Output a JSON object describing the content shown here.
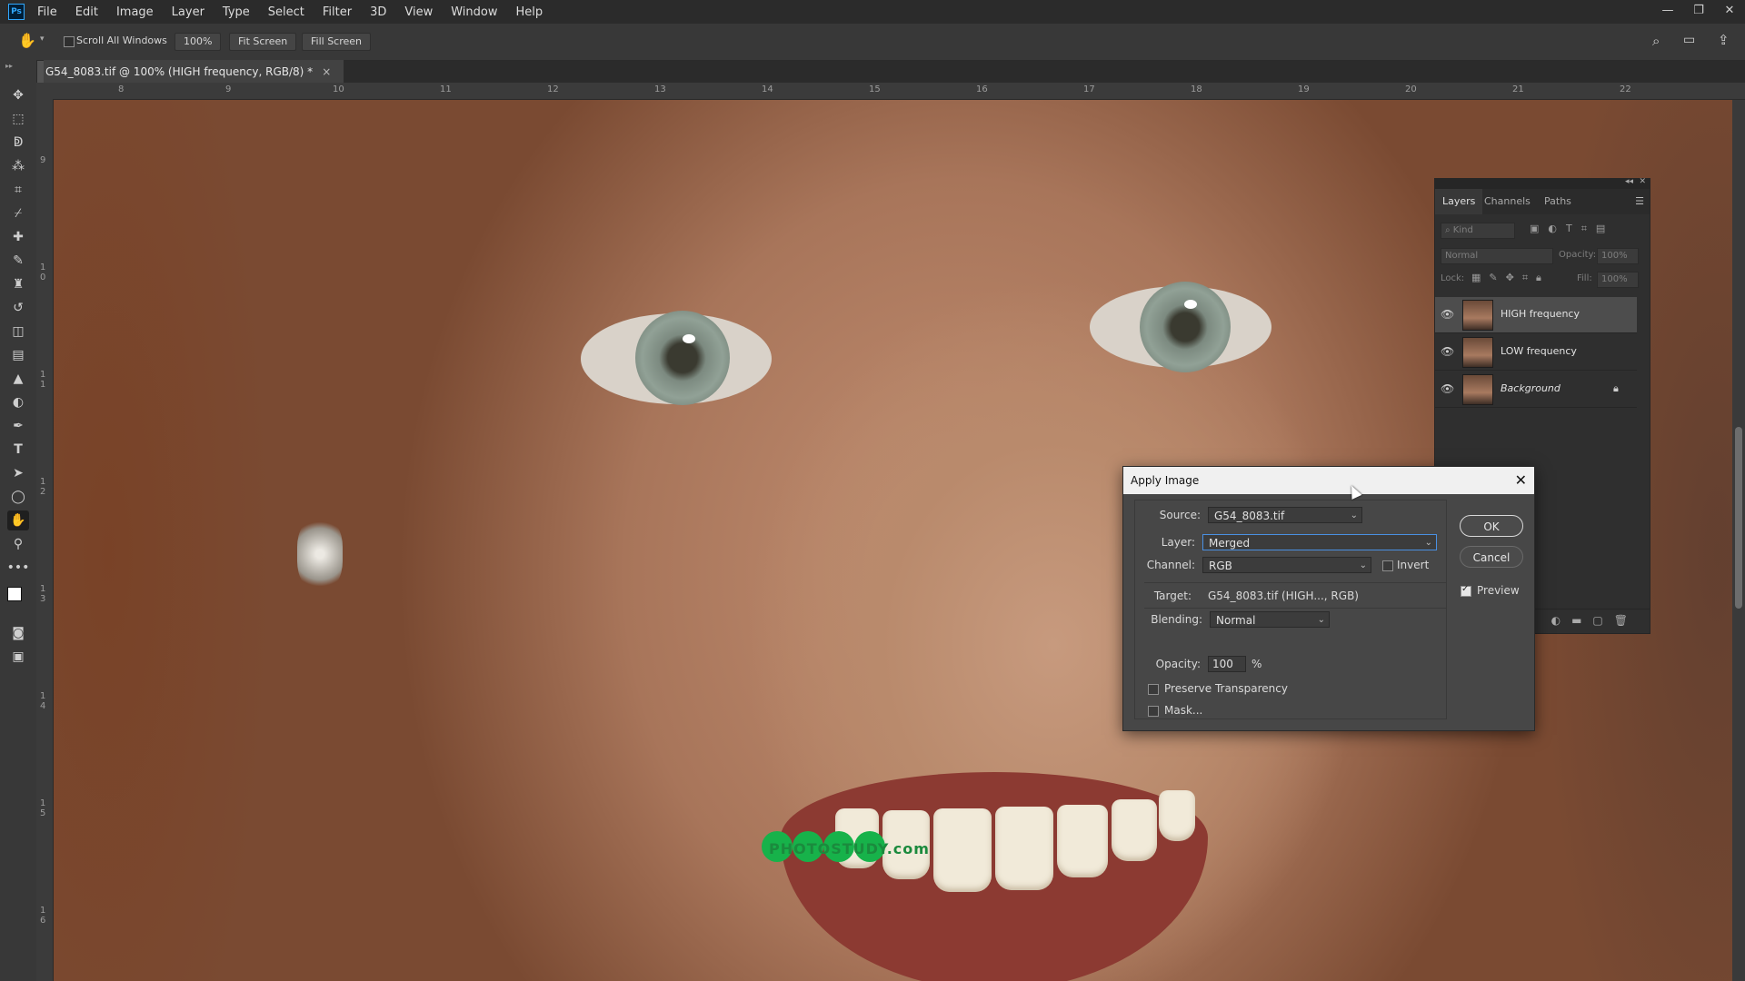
{
  "menubar": {
    "logo": "Ps",
    "items": [
      "File",
      "Edit",
      "Image",
      "Layer",
      "Type",
      "Select",
      "Filter",
      "3D",
      "View",
      "Window",
      "Help"
    ]
  },
  "options": {
    "scroll_all_windows": "Scroll All Windows",
    "zoom": "100%",
    "fit_screen": "Fit Screen",
    "fill_screen": "Fill Screen"
  },
  "document": {
    "tab_title": "G54_8083.tif @ 100% (HIGH frequency, RGB/8) *",
    "close": "×"
  },
  "ruler": {
    "top": [
      "8",
      "9",
      "10",
      "11",
      "12",
      "13",
      "14",
      "15",
      "16",
      "17",
      "18",
      "19",
      "20",
      "21",
      "22"
    ],
    "left": [
      "9",
      "1 0",
      "1 1",
      "1 2",
      "1 3",
      "1 4",
      "1 5",
      "1 6"
    ]
  },
  "layers_panel": {
    "tabs": [
      "Layers",
      "Channels",
      "Paths"
    ],
    "kind_placeholder": "Kind",
    "blend_mode": "Normal",
    "opacity_label": "Opacity:",
    "opacity_value": "100%",
    "lock_label": "Lock:",
    "fill_label": "Fill:",
    "fill_value": "100%",
    "layers": [
      {
        "name": "HIGH frequency",
        "selected": true
      },
      {
        "name": "LOW frequency",
        "selected": false
      },
      {
        "name": "Background",
        "selected": false,
        "locked": true
      }
    ]
  },
  "dialog": {
    "title": "Apply Image",
    "source_label": "Source:",
    "source_value": "G54_8083.tif",
    "layer_label": "Layer:",
    "layer_value": "Merged",
    "channel_label": "Channel:",
    "channel_value": "RGB",
    "invert_label": "Invert",
    "target_label": "Target:",
    "target_value": "G54_8083.tif (HIGH..., RGB)",
    "blending_label": "Blending:",
    "blending_value": "Normal",
    "opacity_label": "Opacity:",
    "opacity_value": "100",
    "opacity_unit": "%",
    "preserve_label": "Preserve Transparency",
    "mask_label": "Mask...",
    "ok": "OK",
    "cancel": "Cancel",
    "preview_label": "Preview",
    "preview_checked": true,
    "invert_checked": false,
    "preserve_checked": false,
    "mask_checked": false
  },
  "watermark": "PHOTOSTUDY.com"
}
